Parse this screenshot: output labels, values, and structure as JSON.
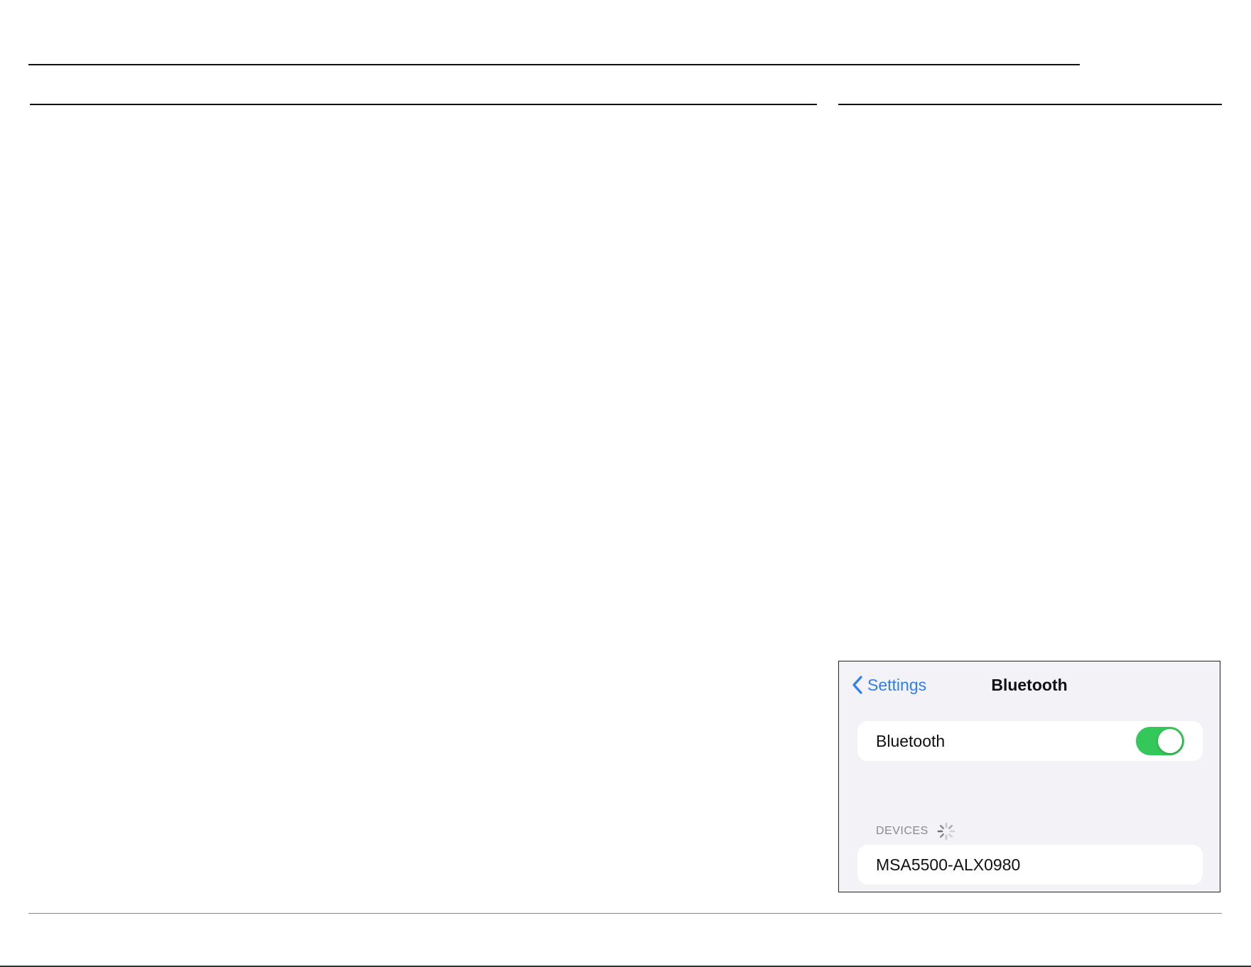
{
  "nav": {
    "back_label": "Settings",
    "title": "Bluetooth"
  },
  "bluetooth_toggle": {
    "label": "Bluetooth",
    "state": "on",
    "color": "#34c759"
  },
  "devices": {
    "header": "DEVICES",
    "items": [
      {
        "name": "MSA5500-ALX0980"
      }
    ]
  },
  "colors": {
    "accent": "#2f7ff0",
    "panel_background": "#f2f2f7"
  },
  "icons": {
    "back": "chevron-left-icon",
    "loading": "spinner-icon"
  }
}
